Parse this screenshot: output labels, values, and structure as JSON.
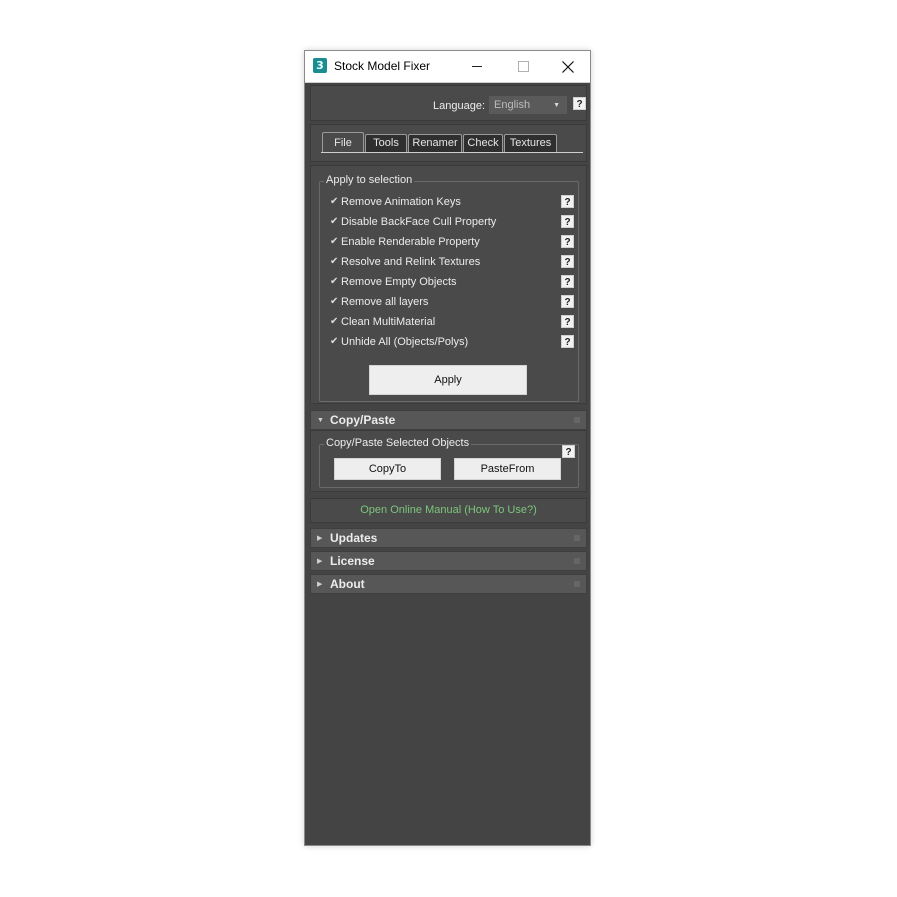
{
  "window": {
    "title": "Stock Model Fixer",
    "icon_glyph": "3"
  },
  "language": {
    "label": "Language:",
    "selected": "English",
    "help": "?"
  },
  "tabs": [
    {
      "label": "File",
      "active": true
    },
    {
      "label": "Tools"
    },
    {
      "label": "Renamer"
    },
    {
      "label": "Check"
    },
    {
      "label": "Textures"
    }
  ],
  "apply_group": {
    "title": "Apply to selection",
    "options": [
      {
        "label": "Remove Animation Keys",
        "checked": true,
        "help": "?"
      },
      {
        "label": "Disable BackFace Cull Property",
        "checked": true,
        "help": "?"
      },
      {
        "label": "Enable Renderable Property",
        "checked": true,
        "help": "?"
      },
      {
        "label": "Resolve and Relink Textures",
        "checked": true,
        "help": "?"
      },
      {
        "label": "Remove Empty Objects",
        "checked": true,
        "help": "?"
      },
      {
        "label": "Remove all layers",
        "checked": true,
        "help": "?"
      },
      {
        "label": "Clean MultiMaterial",
        "checked": true,
        "help": "?"
      },
      {
        "label": "Unhide All (Objects/Polys)",
        "checked": true,
        "help": "?"
      }
    ],
    "check_glyph": "✔",
    "apply_label": "Apply"
  },
  "copy_paste": {
    "rollout_title": "Copy/Paste",
    "expanded": true,
    "group_title": "Copy/Paste Selected Objects",
    "help": "?",
    "copy_label": "CopyTo",
    "paste_label": "PasteFrom"
  },
  "manual_link": "Open Online Manual (How To Use?)",
  "rollouts": [
    {
      "title": "Updates",
      "expanded": false
    },
    {
      "title": "License",
      "expanded": false
    },
    {
      "title": "About",
      "expanded": false
    }
  ],
  "arrows": {
    "expanded": "▼",
    "collapsed": "▶"
  },
  "colors": {
    "panel_bg": "#444444",
    "link_green": "#7cc67c"
  }
}
